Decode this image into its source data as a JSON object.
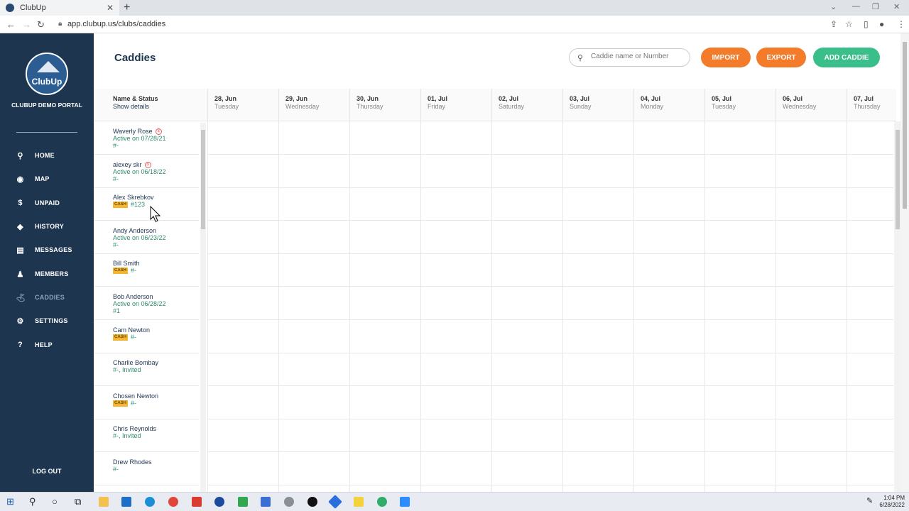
{
  "browser": {
    "tab_title": "ClubUp",
    "url": "app.clubup.us/clubs/caddies"
  },
  "sidebar": {
    "logo_text": "ClubUp",
    "portal_name": "CLUBUP DEMO PORTAL",
    "items": [
      {
        "label": "HOME",
        "icon": "pin-icon"
      },
      {
        "label": "MAP",
        "icon": "map-marker-icon"
      },
      {
        "label": "UNPAID",
        "icon": "dollar-icon"
      },
      {
        "label": "HISTORY",
        "icon": "history-icon"
      },
      {
        "label": "MESSAGES",
        "icon": "message-icon"
      },
      {
        "label": "MEMBERS",
        "icon": "members-icon"
      },
      {
        "label": "CADDIES",
        "icon": "caddie-icon"
      },
      {
        "label": "SETTINGS",
        "icon": "gear-icon"
      },
      {
        "label": "HELP",
        "icon": "help-icon"
      }
    ],
    "active_item": "CADDIES",
    "logout": "LOG OUT"
  },
  "header": {
    "title": "Caddies",
    "search_placeholder": "Caddie name or Number",
    "import_label": "IMPORT",
    "export_label": "EXPORT",
    "add_label": "ADD CADDIE"
  },
  "table": {
    "name_col_title": "Name & Status",
    "name_col_sub": "Show details",
    "days": [
      {
        "date": "28, Jun",
        "day": "Tuesday"
      },
      {
        "date": "29, Jun",
        "day": "Wednesday"
      },
      {
        "date": "30, Jun",
        "day": "Thursday"
      },
      {
        "date": "01, Jul",
        "day": "Friday"
      },
      {
        "date": "02, Jul",
        "day": "Saturday"
      },
      {
        "date": "03, Jul",
        "day": "Sunday"
      },
      {
        "date": "04, Jul",
        "day": "Monday"
      },
      {
        "date": "05, Jul",
        "day": "Tuesday"
      },
      {
        "date": "06, Jul",
        "day": "Wednesday"
      },
      {
        "date": "07, Jul",
        "day": "Thursday"
      }
    ],
    "rows": [
      {
        "name": "Waverly Rose",
        "warn": true,
        "status": "Active on 07/28/21",
        "number": "#-"
      },
      {
        "name": "alexey skr",
        "warn": true,
        "status": "Active on 06/18/22",
        "number": "#-"
      },
      {
        "name": "Alex Skrebkov",
        "cash": "CASH",
        "number": "#123"
      },
      {
        "name": "Andy Anderson",
        "status": "Active on 06/23/22",
        "number": "#-"
      },
      {
        "name": "Bill Smith",
        "cash": "CASH",
        "number": "#-"
      },
      {
        "name": "Bob Anderson",
        "status": "Active on 06/28/22",
        "number": "#1"
      },
      {
        "name": "Cam Newton",
        "cash": "CASH",
        "number": "#-"
      },
      {
        "name": "Charlie Bombay",
        "line2": "#-, Invited"
      },
      {
        "name": "Chosen Newton",
        "cash": "CASH",
        "number": "#-"
      },
      {
        "name": "Chris Reynolds",
        "line2": "#-, Invited"
      },
      {
        "name": "Drew Rhodes",
        "number": "#-"
      }
    ]
  },
  "taskbar": {
    "time": "1:04 PM",
    "date": "6/28/2022"
  },
  "colors": {
    "sidebar_bg": "#1e3550",
    "accent_orange": "#f47b2a",
    "accent_green": "#3bbf8a",
    "cash_badge": "#f3b532"
  }
}
